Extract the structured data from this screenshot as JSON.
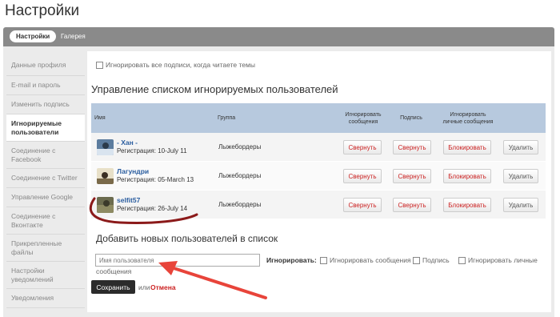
{
  "page": {
    "title": "Настройки"
  },
  "tabs": [
    {
      "label": "Настройки",
      "active": true
    },
    {
      "label": "Галерея",
      "active": false
    }
  ],
  "sidebar": {
    "items": [
      {
        "label": "Данные профиля",
        "active": false
      },
      {
        "label": "E-mail и пароль",
        "active": false
      },
      {
        "label": "Изменить подпись",
        "active": false
      },
      {
        "label": "Игнорируемые пользователи",
        "active": true
      },
      {
        "label": "Соединение с Facebook",
        "active": false
      },
      {
        "label": "Соединение с Twitter",
        "active": false
      },
      {
        "label": "Управление Google",
        "active": false
      },
      {
        "label": "Соединение с Вконтакте",
        "active": false
      },
      {
        "label": "Прикрепленные файлы",
        "active": false
      },
      {
        "label": "Настройки уведомлений",
        "active": false
      },
      {
        "label": "Уведомления",
        "active": false
      }
    ]
  },
  "main": {
    "ignore_all_label": "Игнорировать все подписи, когда читаете темы",
    "section_title": "Управление списком игнорируемых пользователей",
    "table": {
      "headers": {
        "name": "Имя",
        "group": "Группа",
        "ignore_messages": "Игнорировать сообщения",
        "signature": "Подпись",
        "ignore_personal": "Игнорировать личные сообщения"
      },
      "rows": [
        {
          "name": "- Хан -",
          "registered": "Регистрация: 10-July 11",
          "group": "Лыжебордеры",
          "collapse1": "Свернуть",
          "collapse2": "Свернуть",
          "block": "Блокировать",
          "delete": "Удалить"
        },
        {
          "name": "Лагундри",
          "registered": "Регистрация: 05-March 13",
          "group": "Лыжебордеры",
          "collapse1": "Свернуть",
          "collapse2": "Свернуть",
          "block": "Блокировать",
          "delete": "Удалить"
        },
        {
          "name": "selfit57",
          "registered": "Регистрация: 26-July 14",
          "group": "Лыжебордеры",
          "collapse1": "Свернуть",
          "collapse2": "Свернуть",
          "block": "Блокировать",
          "delete": "Удалить"
        }
      ]
    },
    "add": {
      "title": "Добавить новых пользователей в список",
      "username_placeholder": "Имя пользователя",
      "ignore_label": "Игнорировать:",
      "opt_messages": "Игнорировать сообщения",
      "opt_signature": "Подпись",
      "opt_personal": "Игнорировать личные",
      "opt_personal_wrap": "сообщения",
      "save": "Сохранить",
      "or": "или",
      "cancel": "Отмена"
    }
  },
  "colors": {
    "accent_red": "#cc2222",
    "annotation_red": "#e8443a",
    "underline_dark_red": "#8b1a1a",
    "table_header": "#b7c9de",
    "link_blue": "#2a5d9f"
  }
}
